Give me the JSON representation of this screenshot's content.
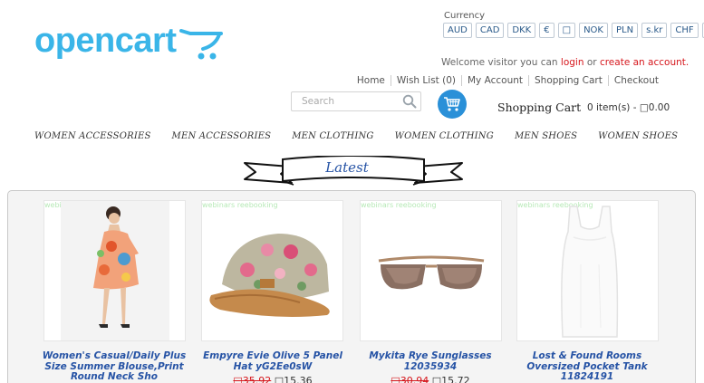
{
  "header": {
    "logo_text": "opencart",
    "currency_label": "Currency",
    "currencies": [
      "AUD",
      "CAD",
      "DKK",
      "€",
      "□",
      "NOK",
      "PLN",
      "s.kr",
      "CHF",
      "$"
    ],
    "welcome_prefix": "Welcome visitor you can",
    "login_label": "login",
    "welcome_or": "or",
    "create_account_label": "create an account.",
    "top_links": [
      "Home",
      "Wish List (0)",
      "My Account",
      "Shopping Cart",
      "Checkout"
    ],
    "search_placeholder": "Search",
    "cart_title": "Shopping Cart",
    "cart_summary": "0 item(s) - □0.00"
  },
  "menu": [
    "WOMEN ACCESSORIES",
    "MEN ACCESSORIES",
    "MEN CLOTHING",
    "WOMEN CLOTHING",
    "MEN SHOES",
    "WOMEN SHOES"
  ],
  "section_title": "Latest",
  "products": [
    {
      "ribbon": "webinars reebooking",
      "name_lines": [
        "Women's Casual/Daily Plus",
        "Size Summer Blouse,Print",
        "Round Neck Sho"
      ],
      "old_price": "",
      "new_price": ""
    },
    {
      "ribbon": "webinars reebooking",
      "name_lines": [
        "Empyre Evie Olive 5 Panel",
        "Hat yG2Ee0sW"
      ],
      "old_price": "□35.92",
      "new_price": "□15.36"
    },
    {
      "ribbon": "webinars reebooking",
      "name_lines": [
        "Mykita Rye Sunglasses",
        "12035934"
      ],
      "old_price": "□30.94",
      "new_price": "□15.72"
    },
    {
      "ribbon": "webinars reebooking",
      "name_lines": [
        "Lost & Found Rooms",
        "Oversized Pocket Tank",
        "11824191"
      ],
      "old_price": "",
      "new_price": ""
    }
  ]
}
